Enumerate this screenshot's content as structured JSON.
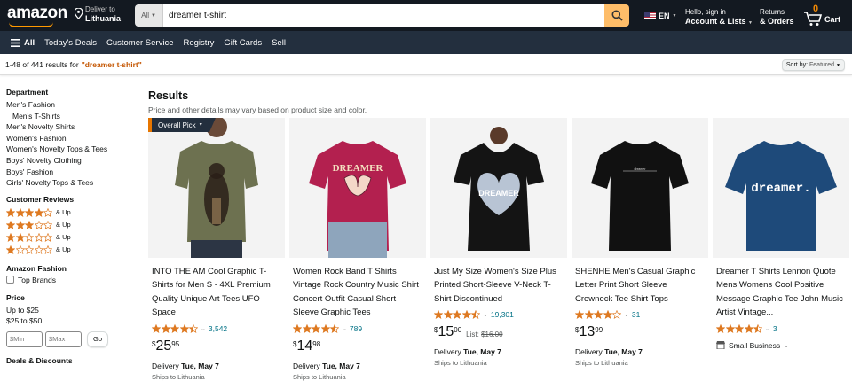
{
  "header": {
    "logo": "amazon",
    "deliver_to_line1": "Deliver to",
    "deliver_to_line2": "Lithuania",
    "search_category": "All",
    "search_query": "dreamer t-shirt",
    "language": "EN",
    "account_line1": "Hello, sign in",
    "account_line2": "Account & Lists",
    "returns_line1": "Returns",
    "returns_line2": "& Orders",
    "cart_count": "0",
    "cart_label": "Cart"
  },
  "subnav": {
    "all": "All",
    "items": [
      "Today's Deals",
      "Customer Service",
      "Registry",
      "Gift Cards",
      "Sell"
    ]
  },
  "results_bar": {
    "count_text": "1-48 of 441 results for",
    "query": "\"dreamer t-shirt\"",
    "sort_label": "Sort by:",
    "sort_value": "Featured"
  },
  "sidebar": {
    "department_heading": "Department",
    "departments": [
      {
        "label": "Men's Fashion",
        "indent": false
      },
      {
        "label": "Men's T-Shirts",
        "indent": true
      },
      {
        "label": "Men's Novelty Shirts",
        "indent": false
      },
      {
        "label": "Women's Fashion",
        "indent": false
      },
      {
        "label": "Women's Novelty Tops & Tees",
        "indent": false
      },
      {
        "label": "Boys' Novelty Clothing",
        "indent": false
      },
      {
        "label": "Boys' Fashion",
        "indent": false
      },
      {
        "label": "Girls' Novelty Tops & Tees",
        "indent": false
      }
    ],
    "reviews_heading": "Customer Reviews",
    "review_rows": [
      {
        "stars": 4,
        "label": "& Up"
      },
      {
        "stars": 3,
        "label": "& Up"
      },
      {
        "stars": 2,
        "label": "& Up"
      },
      {
        "stars": 1,
        "label": "& Up"
      }
    ],
    "fashion_heading": "Amazon Fashion",
    "top_brands": "Top Brands",
    "price_heading": "Price",
    "price_ranges": [
      "Up to $25",
      "$25 to $50"
    ],
    "min_placeholder": "$Min",
    "max_placeholder": "$Max",
    "go_label": "Go",
    "deals_heading": "Deals & Discounts"
  },
  "results": {
    "title": "Results",
    "subtitle": "Price and other details may vary based on product size and color.",
    "overall_pick": "Overall Pick"
  },
  "products": [
    {
      "title": "INTO THE AM Cool Graphic T-Shirts for Men S - 4XL Premium Quality Unique Art Tees UFO Space",
      "rating": 4.5,
      "reviews": "3,542",
      "price_whole": "25",
      "price_frac": "95",
      "list_label": "",
      "list_price": "",
      "delivery_prefix": "Delivery",
      "delivery_date": "Tue, May 7",
      "ships": "Ships to Lithuania",
      "shirt_color": "#6d7150",
      "print_text": ""
    },
    {
      "title": "Women Rock Band T Shirts Vintage Rock Country Music Shirt Concert Outfit Casual Short Sleeve Graphic Tees",
      "rating": 4.5,
      "reviews": "789",
      "price_whole": "14",
      "price_frac": "98",
      "list_label": "",
      "list_price": "",
      "delivery_prefix": "Delivery",
      "delivery_date": "Tue, May 7",
      "ships": "Ships to Lithuania",
      "shirt_color": "#b3204f",
      "print_text": "DREAMER"
    },
    {
      "title": "Just My Size Women's Size Plus Printed Short-Sleeve V-Neck T-Shirt Discontinued",
      "rating": 4.5,
      "reviews": "19,301",
      "price_whole": "15",
      "price_frac": "00",
      "list_label": "List:",
      "list_price": "$16.00",
      "delivery_prefix": "Delivery",
      "delivery_date": "Tue, May 7",
      "ships": "Ships to Lithuania",
      "shirt_color": "#141414",
      "print_text": "DREAMER"
    },
    {
      "title": "SHENHE Men's Casual Graphic Letter Print Short Sleeve Crewneck Tee Shirt Tops",
      "rating": 4.0,
      "reviews": "31",
      "price_whole": "13",
      "price_frac": "99",
      "list_label": "",
      "list_price": "",
      "delivery_prefix": "Delivery",
      "delivery_date": "Tue, May 7",
      "ships": "Ships to Lithuania",
      "shirt_color": "#111111",
      "print_text": "dreamer"
    },
    {
      "title": "Dreamer T Shirts Lennon Quote Mens Womens Cool Positive Message Graphic Tee John Music Artist Vintage...",
      "rating": 4.5,
      "reviews": "3",
      "price_whole": "",
      "price_frac": "",
      "list_label": "",
      "list_price": "",
      "delivery_prefix": "",
      "delivery_date": "",
      "ships": "",
      "small_business": "Small Business",
      "shirt_color": "#1e4a7a",
      "print_text": "dreamer."
    }
  ]
}
